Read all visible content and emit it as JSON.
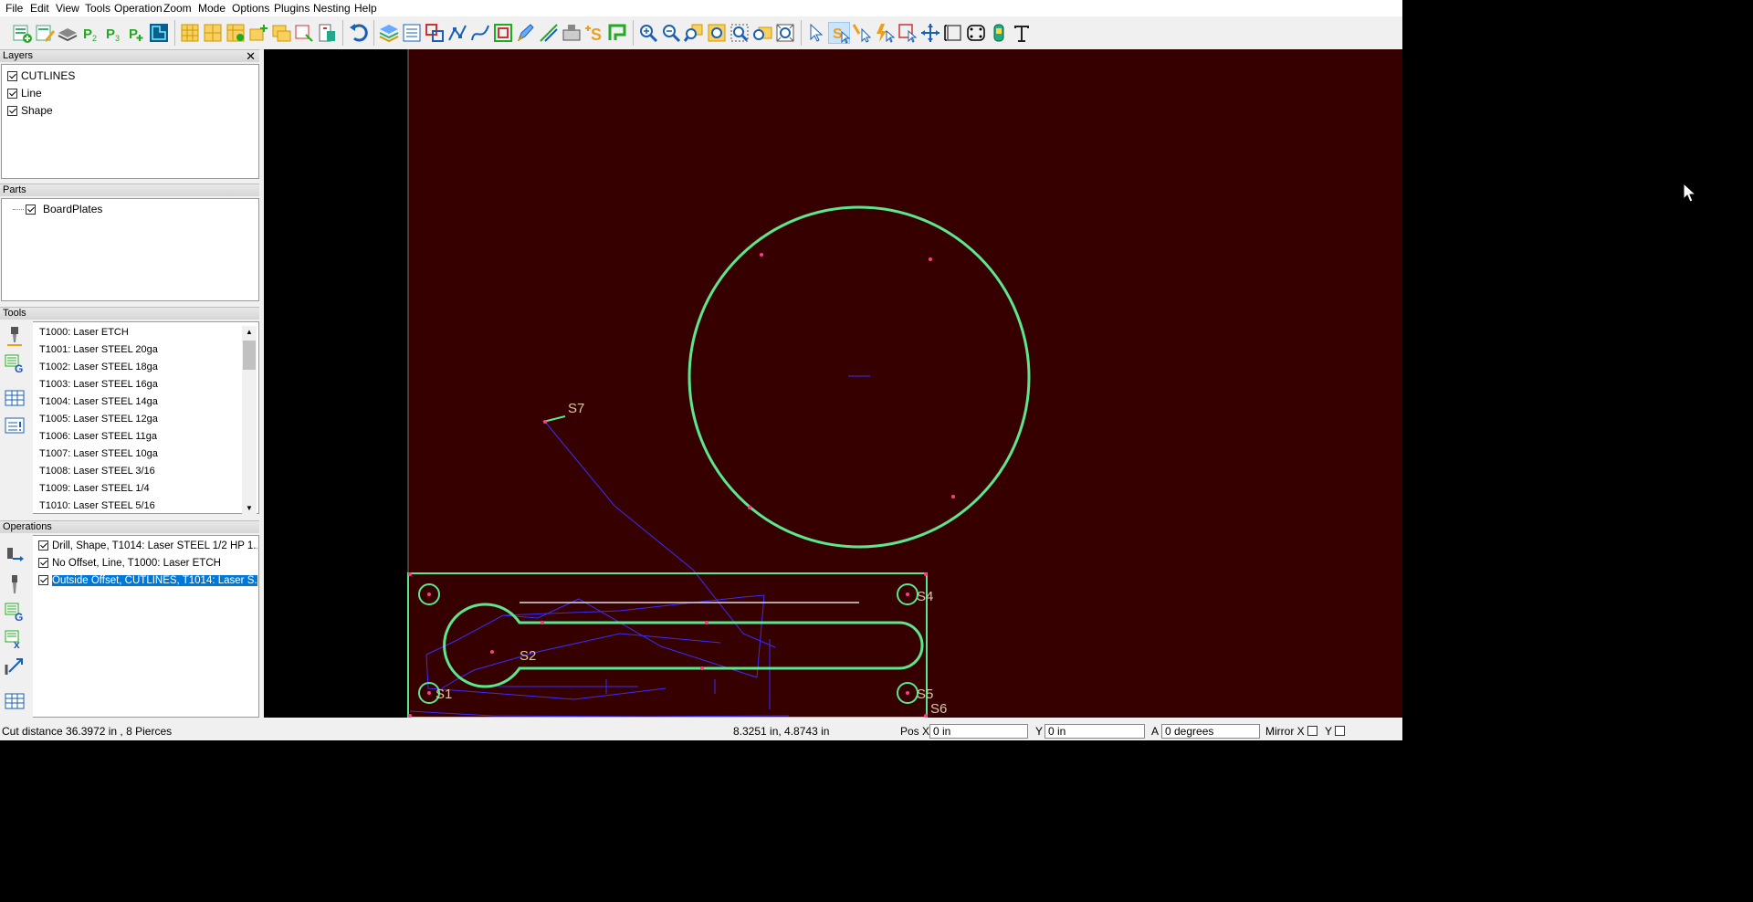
{
  "menu": [
    "File",
    "Edit",
    "View",
    "Tools",
    "Operation",
    "Zoom",
    "Mode",
    "Options",
    "Plugins",
    "Nesting",
    "Help"
  ],
  "toolbar_icons": [
    "new-icon",
    "edit-icon",
    "layers-stack-icon",
    "p2-icon",
    "p3-icon",
    "p-plus-icon",
    "nest-icon",
    "grid-icon",
    "grid2-icon",
    "grid3-icon",
    "add-part-icon",
    "add-part2-icon",
    "add-part3-icon",
    "export-icon",
    "save-icon",
    "undo-icon",
    "layers-icon",
    "list-icon",
    "shapes-icon",
    "nodes-icon",
    "curve-icon",
    "offset-icon",
    "pen-icon",
    "line-icon",
    "machine-icon",
    "add-s-icon",
    "path-icon",
    "zoom-in-icon",
    "zoom-out-icon",
    "zoom-fit-icon",
    "zoom-all-icon",
    "zoom-window-icon",
    "zoom-sel-icon",
    "zoom-extents-icon",
    "select-icon",
    "select-s-icon",
    "node-edit-icon",
    "flash-select-icon",
    "rect-select-icon",
    "move-icon",
    "measure-icon",
    "rounded-rect-icon",
    "cylinder-icon",
    "text-icon"
  ],
  "layers": {
    "title": "Layers",
    "items": [
      {
        "label": "CUTLINES",
        "checked": true
      },
      {
        "label": "Line",
        "checked": true
      },
      {
        "label": "Shape",
        "checked": true
      }
    ]
  },
  "parts": {
    "title": "Parts",
    "items": [
      {
        "label": "BoardPlates",
        "checked": true
      }
    ]
  },
  "tools": {
    "title": "Tools",
    "items": [
      "T1000: Laser ETCH",
      "T1001: Laser STEEL 20ga",
      "T1002: Laser STEEL 18ga",
      "T1003: Laser STEEL 16ga",
      "T1004: Laser STEEL 14ga",
      "T1005: Laser STEEL 12ga",
      "T1006: Laser STEEL 11ga",
      "T1007: Laser STEEL 10ga",
      "T1008: Laser STEEL 3/16",
      "T1009: Laser STEEL 1/4",
      "T1010: Laser STEEL 5/16"
    ]
  },
  "operations": {
    "title": "Operations",
    "items": [
      {
        "label": "Drill, Shape, T1014: Laser STEEL 1/2 HP 1....",
        "checked": true,
        "selected": false
      },
      {
        "label": "No Offset, Line, T1000: Laser ETCH",
        "checked": true,
        "selected": false
      },
      {
        "label": "Outside Offset, CUTLINES, T1014: Laser S...",
        "checked": true,
        "selected": true
      }
    ]
  },
  "canvas": {
    "labels": [
      "S7",
      "S2",
      "S4",
      "S1",
      "S5",
      "S6"
    ]
  },
  "status": {
    "cut_info": "Cut distance 36.3972 in , 8 Pierces",
    "cursor_pos": "8.3251 in, 4.8743 in",
    "pos_x_label": "Pos X",
    "pos_x_value": "0 in",
    "y_label": "Y",
    "y_value": "0 in",
    "a_label": "A",
    "a_value": "0 degrees",
    "mirror_x_label": "Mirror X",
    "mirror_y_label": "Y"
  },
  "colors": {
    "canvas_bg": "#360000",
    "cut_path": "#5de68a",
    "rapid_path": "#3a2cff",
    "selection": "#0078d7"
  }
}
